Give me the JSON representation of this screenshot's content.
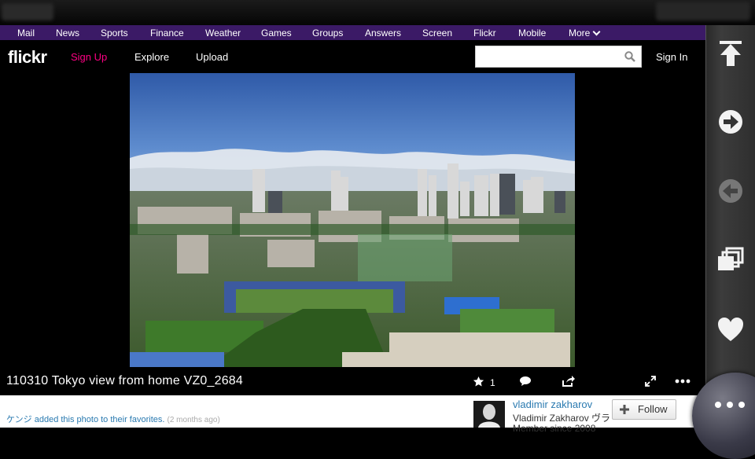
{
  "yahoo_nav": {
    "items": [
      "Mail",
      "News",
      "Sports",
      "Finance",
      "Weather",
      "Games",
      "Groups",
      "Answers",
      "Screen",
      "Flickr",
      "Mobile",
      "More"
    ]
  },
  "flickr_header": {
    "logo": "flickr",
    "sign_up": "Sign Up",
    "explore": "Explore",
    "upload": "Upload",
    "search_placeholder": "",
    "sign_in": "Sign In"
  },
  "photo": {
    "title": "110310 Tokyo view from home VZ0_2684",
    "favorite_count": "1"
  },
  "activity": {
    "text": "ケンジ added this photo to their favorites.",
    "time": "(2 months ago)"
  },
  "author": {
    "link_name": "vladimir zakharov",
    "full_name": "Vladimir Zakharov ヴラ",
    "meta": "Member since 2008",
    "follow_label": "Follow"
  },
  "side_panel": {
    "buttons": [
      "scroll-top-icon",
      "forward-icon",
      "back-icon",
      "tabs-icon",
      "favorite-heart-icon"
    ]
  },
  "colors": {
    "nav_bg": "#3b1a66",
    "signup": "#ff0084",
    "link": "#2a7ab0"
  }
}
